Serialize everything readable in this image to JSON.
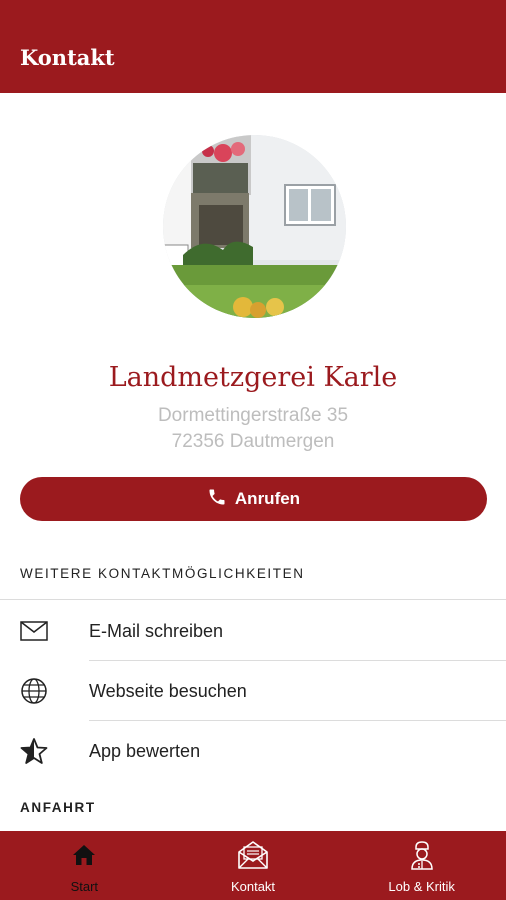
{
  "app_bar": {
    "title": "Kontakt"
  },
  "business": {
    "name": "Landmetzgerei Karle",
    "address_line1": "Dormettingerstraße 35",
    "address_line2": "72356 Dautmergen"
  },
  "call_button": {
    "label": "Anrufen",
    "icon": "phone-icon"
  },
  "more_contact": {
    "heading": "WEITERE KONTAKTMÖGLICHKEITEN",
    "items": [
      {
        "label": "E-Mail schreiben",
        "icon": "envelope-icon"
      },
      {
        "label": "Webseite besuchen",
        "icon": "globe-icon"
      },
      {
        "label": "App bewerten",
        "icon": "star-icon"
      }
    ]
  },
  "directions": {
    "heading": "ANFAHRT"
  },
  "tabbar": {
    "active_index": 0,
    "tabs": [
      {
        "label": "Start",
        "icon": "home-icon"
      },
      {
        "label": "Kontakt",
        "icon": "mail-envelope-icon"
      },
      {
        "label": "Lob & Kritik",
        "icon": "chef-icon"
      }
    ]
  },
  "colors": {
    "brand": "#9b1a1e",
    "address": "#bdbdbd",
    "divider": "#dcdcdc"
  }
}
